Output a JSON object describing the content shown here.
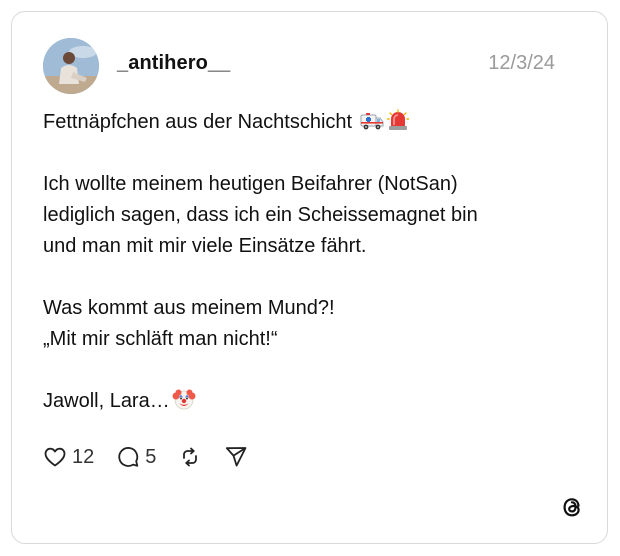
{
  "post": {
    "username": "_antihero__",
    "date": "12/3/24",
    "lines": [
      "Fettnäpfchen aus der Nachtschicht",
      "Ich wollte meinem heutigen Beifahrer (NotSan)",
      "lediglich sagen, dass ich ein Scheissemagnet bin",
      "und man mit mir viele Einsätze fährt.",
      "Was kommt aus meinem Mund?!",
      "„Mit mir schläft man nicht!“",
      "Jawoll, Lara…"
    ],
    "emojis": [
      "ambulance-emoji",
      "police-light-emoji",
      "clown-face-emoji"
    ]
  },
  "actions": {
    "likes": "12",
    "comments": "5",
    "icons": [
      "heart-icon",
      "comment-icon",
      "repost-icon",
      "share-icon"
    ]
  },
  "brand": {
    "logo_icon": "threads-logo-icon",
    "siren_color": "#e53935",
    "text_color": "#111111",
    "muted_color": "#9a9a9a"
  }
}
